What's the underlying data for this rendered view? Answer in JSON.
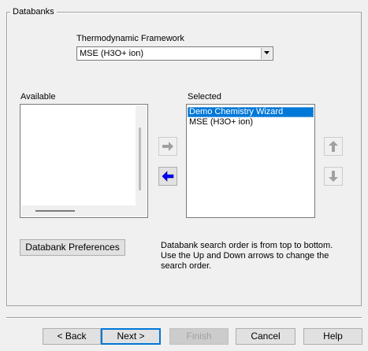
{
  "group": {
    "title": "Databanks"
  },
  "framework": {
    "label": "Thermodynamic Framework",
    "selected": "MSE (H3O+ ion)"
  },
  "available": {
    "label": "Available",
    "items": []
  },
  "selected_list": {
    "label": "Selected",
    "items": [
      "Demo Chemistry Wizard",
      "MSE (H3O+ ion)"
    ]
  },
  "preferences_button": "Databank Preferences",
  "info_text": [
    "Databank search order is from top to bottom.",
    "Use the Up and Down arrows to change the",
    "search order."
  ],
  "footer": {
    "back": "< Back",
    "next": "Next >",
    "finish": "Finish",
    "cancel": "Cancel",
    "help": "Help"
  },
  "icons": {
    "add": "right-arrow-icon",
    "remove": "left-arrow-icon",
    "move_up": "up-arrow-icon",
    "move_down": "down-arrow-icon"
  },
  "colors": {
    "selection": "#0078d7",
    "remove_arrow": "#0000ff",
    "disabled_arrow": "#a0a0a0"
  }
}
